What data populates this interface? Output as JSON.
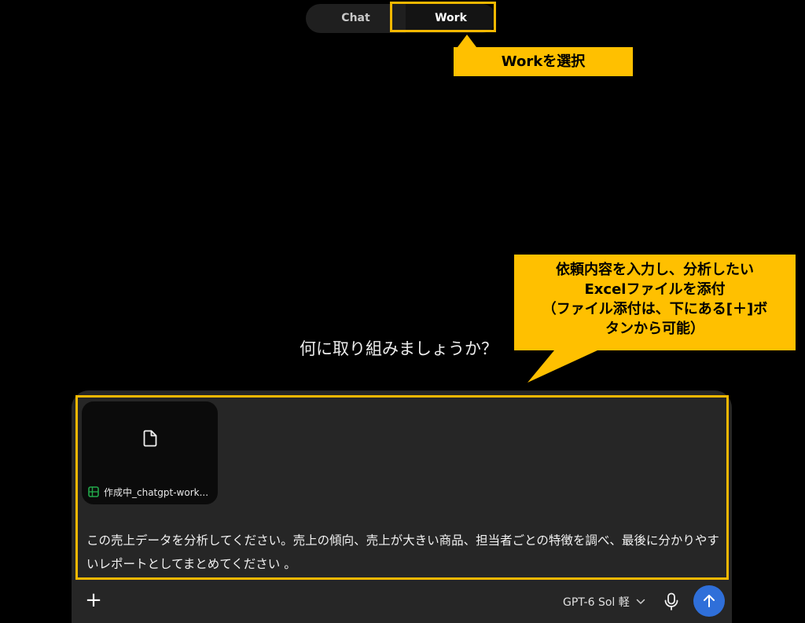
{
  "mode_tabs": {
    "chat": "Chat",
    "work": "Work"
  },
  "annotations": {
    "select_work": "Workを選択",
    "instruction_lines": [
      "依頼内容を入力し、分析したい",
      "Excelファイルを添付",
      "（ファイル添付は、下にある[＋]ボ",
      "タンから可能）"
    ]
  },
  "main": {
    "question": "何に取り組みましょうか？"
  },
  "composer": {
    "attachment": {
      "file_name": "作成中_chatgpt-work...",
      "icon": "spreadsheet-icon"
    },
    "prompt_text": "この売上データを分析してください。売上の傾向、売上が大きい商品、担当者ごとの特徴を調べ、最後に分かりやすいレポートとしてまとめてください 。",
    "add_label": "+",
    "model_label": "GPT-6 Sol 軽"
  },
  "colors": {
    "highlight": "#f5b800",
    "callout": "#ffc000",
    "send_button": "#2f6fd9",
    "sheet_icon": "#22a84a"
  }
}
